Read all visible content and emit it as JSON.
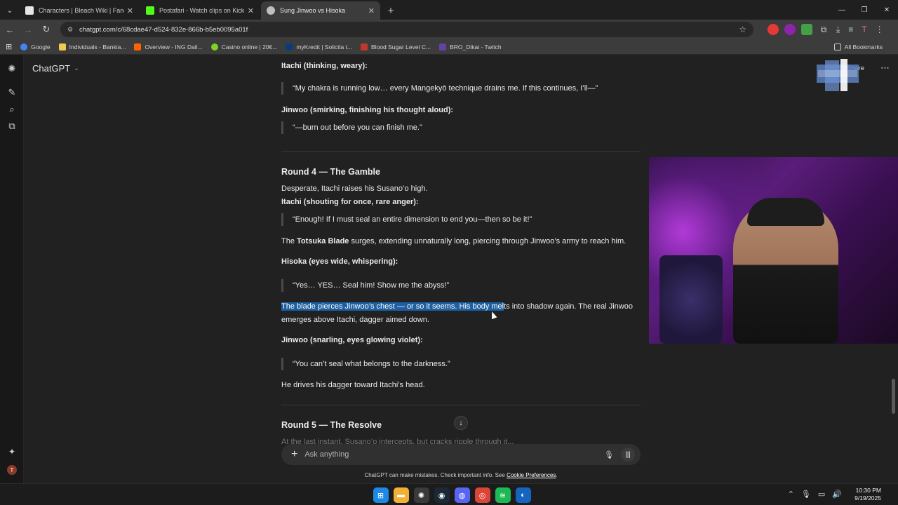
{
  "browser": {
    "tabs": [
      {
        "title": "Characters | Bleach Wiki | Fandom",
        "active": false,
        "favicon_color": "#e6e6e6"
      },
      {
        "title": "Postafari - Watch clips on Kick",
        "active": false,
        "favicon_color": "#53fc18"
      },
      {
        "title": "Sung Jinwoo vs Hisoka",
        "active": true,
        "favicon_color": "#bfbfbf"
      }
    ],
    "url": "chatgpt.com/c/68cdae47-d524-832e-866b-b5eb0095a01f",
    "bookmarks": [
      {
        "label": "Google",
        "color": "#4285f4"
      },
      {
        "label": "Individuals - Bankia...",
        "color": "#f2c94c"
      },
      {
        "label": "Overview - ING Dail...",
        "color": "#ff6200"
      },
      {
        "label": "Casino online | 20€...",
        "color": "#7ed321"
      },
      {
        "label": "myKredit | Solicita t...",
        "color": "#0a3c7d"
      },
      {
        "label": "Blood Sugar Level C...",
        "color": "#c0392b"
      },
      {
        "label": "BRO_Dikai - Twitch",
        "color": "#6441a5"
      }
    ],
    "all_bookmarks": "All Bookmarks"
  },
  "chatgpt": {
    "model": "ChatGPT",
    "share": "Share",
    "composer_placeholder": "Ask anything",
    "disclaimer_prefix": "ChatGPT can make mistakes. Check important info. See",
    "disclaimer_link": "Cookie Preferences",
    "disclaimer_suffix": "."
  },
  "conversation": {
    "itachi_weary": "Itachi (thinking, weary):",
    "itachi_quote": "“My chakra is running low… every Mangekyō technique drains me. If this continues, I’ll—”",
    "jinwoo_smirk": "Jinwoo (smirking, finishing his thought aloud):",
    "jinwoo_quote": "“—burn out before you can finish me.”",
    "round4_title": "Round 4 — The Gamble",
    "desperate": "Desperate, Itachi raises his Susano’o high.",
    "itachi_shout": "Itachi (shouting for once, rare anger):",
    "enough_quote": "“Enough! If I must seal an entire dimension to end you—then so be it!”",
    "totsuka_pre": "The",
    "totsuka_bold": "Totsuka Blade",
    "totsuka_post": "surges, extending unnaturally long, piercing through Jinwoo’s army to reach him.",
    "hisoka_whisper": "Hisoka (eyes wide, whispering):",
    "hisoka_quote": "“Yes… YES… Seal him! Show me the abyss!”",
    "blade_selected": "The blade pierces Jinwoo’s chest — or so it seems. His body mel",
    "blade_rest": "ts into shadow again. The real Jinwoo",
    "blade_line2": "emerges above Itachi, dagger aimed down.",
    "jinwoo_snarl": "Jinwoo (snarling, eyes glowing violet):",
    "jinwoo_quote2": "“You can’t seal what belongs to the darkness.”",
    "dagger": "He drives his dagger toward Itachi’s head.",
    "round5_title": "Round 5 — The Resolve",
    "round5_cut": "At the last instant, Susano’o intercepts, but cracks ripple through it..."
  },
  "taskbar": {
    "time": "10:30 PM",
    "date": "9/19/2025"
  },
  "icons": {
    "lock": "tune-icon",
    "star": "star-icon",
    "new_chat": "edit-icon",
    "search": "search-icon",
    "library": "library-icon",
    "mic": "mic-icon",
    "voice": "voice-icon"
  }
}
